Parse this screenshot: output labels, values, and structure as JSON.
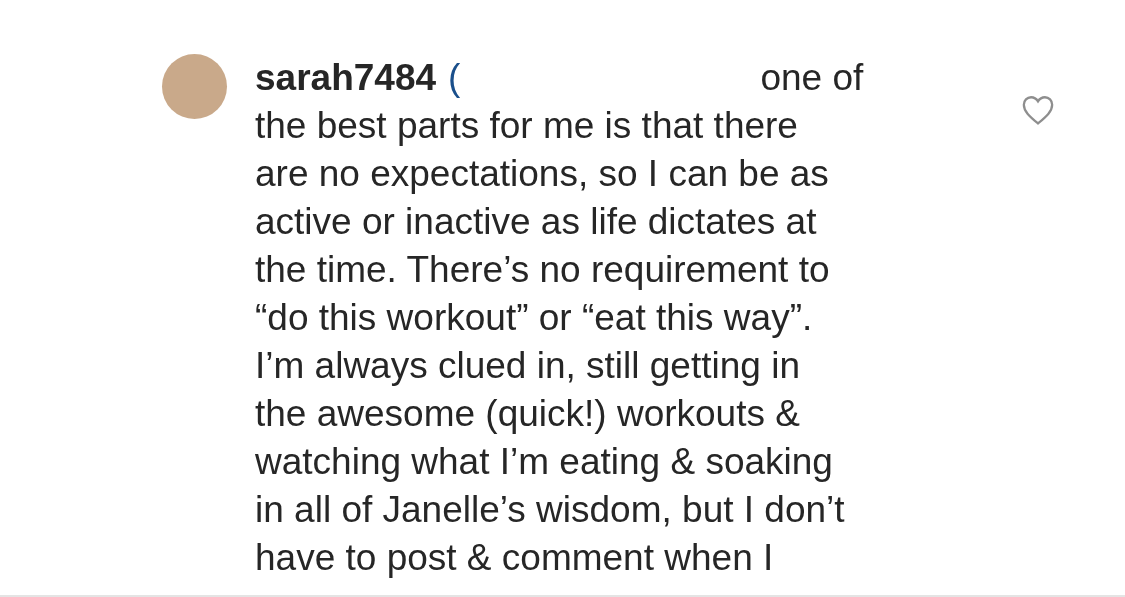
{
  "comment": {
    "username": "sarah7484",
    "mention": "(",
    "liked": false,
    "lines": [
      "one of",
      "the best parts for me is that there",
      "are no expectations, so I can be as",
      "active or inactive as life dictates at",
      "the time. There’s no requirement to",
      "“do this workout” or “eat this way”.",
      "I’m always clued in, still getting in",
      "the awesome (quick!) workouts &",
      "watching what I’m eating & soaking",
      "in all of Janelle’s wisdom, but I don’t",
      "have to post & comment when I"
    ]
  }
}
